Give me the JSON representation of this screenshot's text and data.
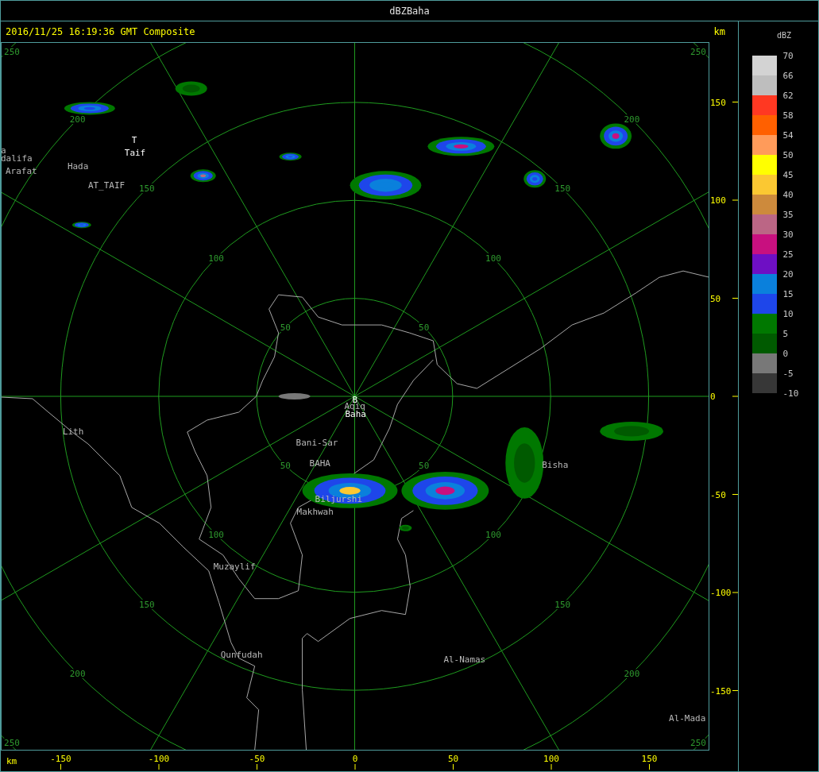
{
  "window": {
    "title": "dBZBaha"
  },
  "header": {
    "timestamp": "2016/11/25 16:19:36 GMT Composite",
    "unit": "km"
  },
  "radar": {
    "rings": [
      {
        "labels": [
          "50",
          "50",
          "50",
          "50"
        ]
      },
      {
        "labels": [
          "100",
          "100",
          "100",
          "100"
        ]
      },
      {
        "labels": [
          "150",
          "150",
          "150",
          "150"
        ]
      },
      {
        "labels": [
          "200",
          "200",
          "200",
          "200"
        ]
      },
      {
        "labels": [
          "250",
          "250",
          "250",
          "250"
        ]
      }
    ],
    "places": [
      {
        "name": "T",
        "kind": "station"
      },
      {
        "name": "Taif",
        "kind": "station"
      },
      {
        "name": "a",
        "kind": "town"
      },
      {
        "name": "dalifa",
        "kind": "town"
      },
      {
        "name": "Hada",
        "kind": "town"
      },
      {
        "name": "Arafat",
        "kind": "town"
      },
      {
        "name": "AT_TAIF",
        "kind": "town"
      },
      {
        "name": "B",
        "kind": "station"
      },
      {
        "name": "Aqiq",
        "kind": "town"
      },
      {
        "name": "Baha",
        "kind": "station"
      },
      {
        "name": "Lith",
        "kind": "town"
      },
      {
        "name": "Bani-Sar",
        "kind": "town"
      },
      {
        "name": "BAHA",
        "kind": "town"
      },
      {
        "name": "Bisha",
        "kind": "town"
      },
      {
        "name": "Biljurshi",
        "kind": "town"
      },
      {
        "name": "Makhwah",
        "kind": "town"
      },
      {
        "name": "Muzaylif",
        "kind": "town"
      },
      {
        "name": "Qunfudah",
        "kind": "town"
      },
      {
        "name": "Al-Namas",
        "kind": "town"
      },
      {
        "name": "Al-Mada",
        "kind": "town"
      }
    ]
  },
  "y_axis": {
    "ticks": [
      "150",
      "100",
      "50",
      "0",
      "-50",
      "-100",
      "-150"
    ]
  },
  "x_axis": {
    "unit": "km",
    "ticks": [
      "-150",
      "-100",
      "-50",
      "0",
      "50",
      "100",
      "150"
    ]
  },
  "legend": {
    "unit": "dBZ",
    "bins": [
      {
        "color": "#d3d3d3"
      },
      {
        "color": "#bebebe"
      },
      {
        "color": "#ff3822"
      },
      {
        "color": "#ff6000"
      },
      {
        "color": "#ff9b5a"
      },
      {
        "color": "#ffff00"
      },
      {
        "color": "#fbc832"
      },
      {
        "color": "#cd8a3c"
      },
      {
        "color": "#bb6685"
      },
      {
        "color": "#c8107f"
      },
      {
        "color": "#6e0fc4"
      },
      {
        "color": "#0a80dc"
      },
      {
        "color": "#1e46ea"
      },
      {
        "color": "#007800"
      },
      {
        "color": "#005a00"
      },
      {
        "color": "#787878"
      },
      {
        "color": "#373737"
      }
    ],
    "labels": [
      "70",
      "66",
      "62",
      "58",
      "54",
      "50",
      "45",
      "40",
      "35",
      "30",
      "25",
      "20",
      "15",
      "10",
      "5",
      "0",
      "-5",
      "-10"
    ]
  }
}
